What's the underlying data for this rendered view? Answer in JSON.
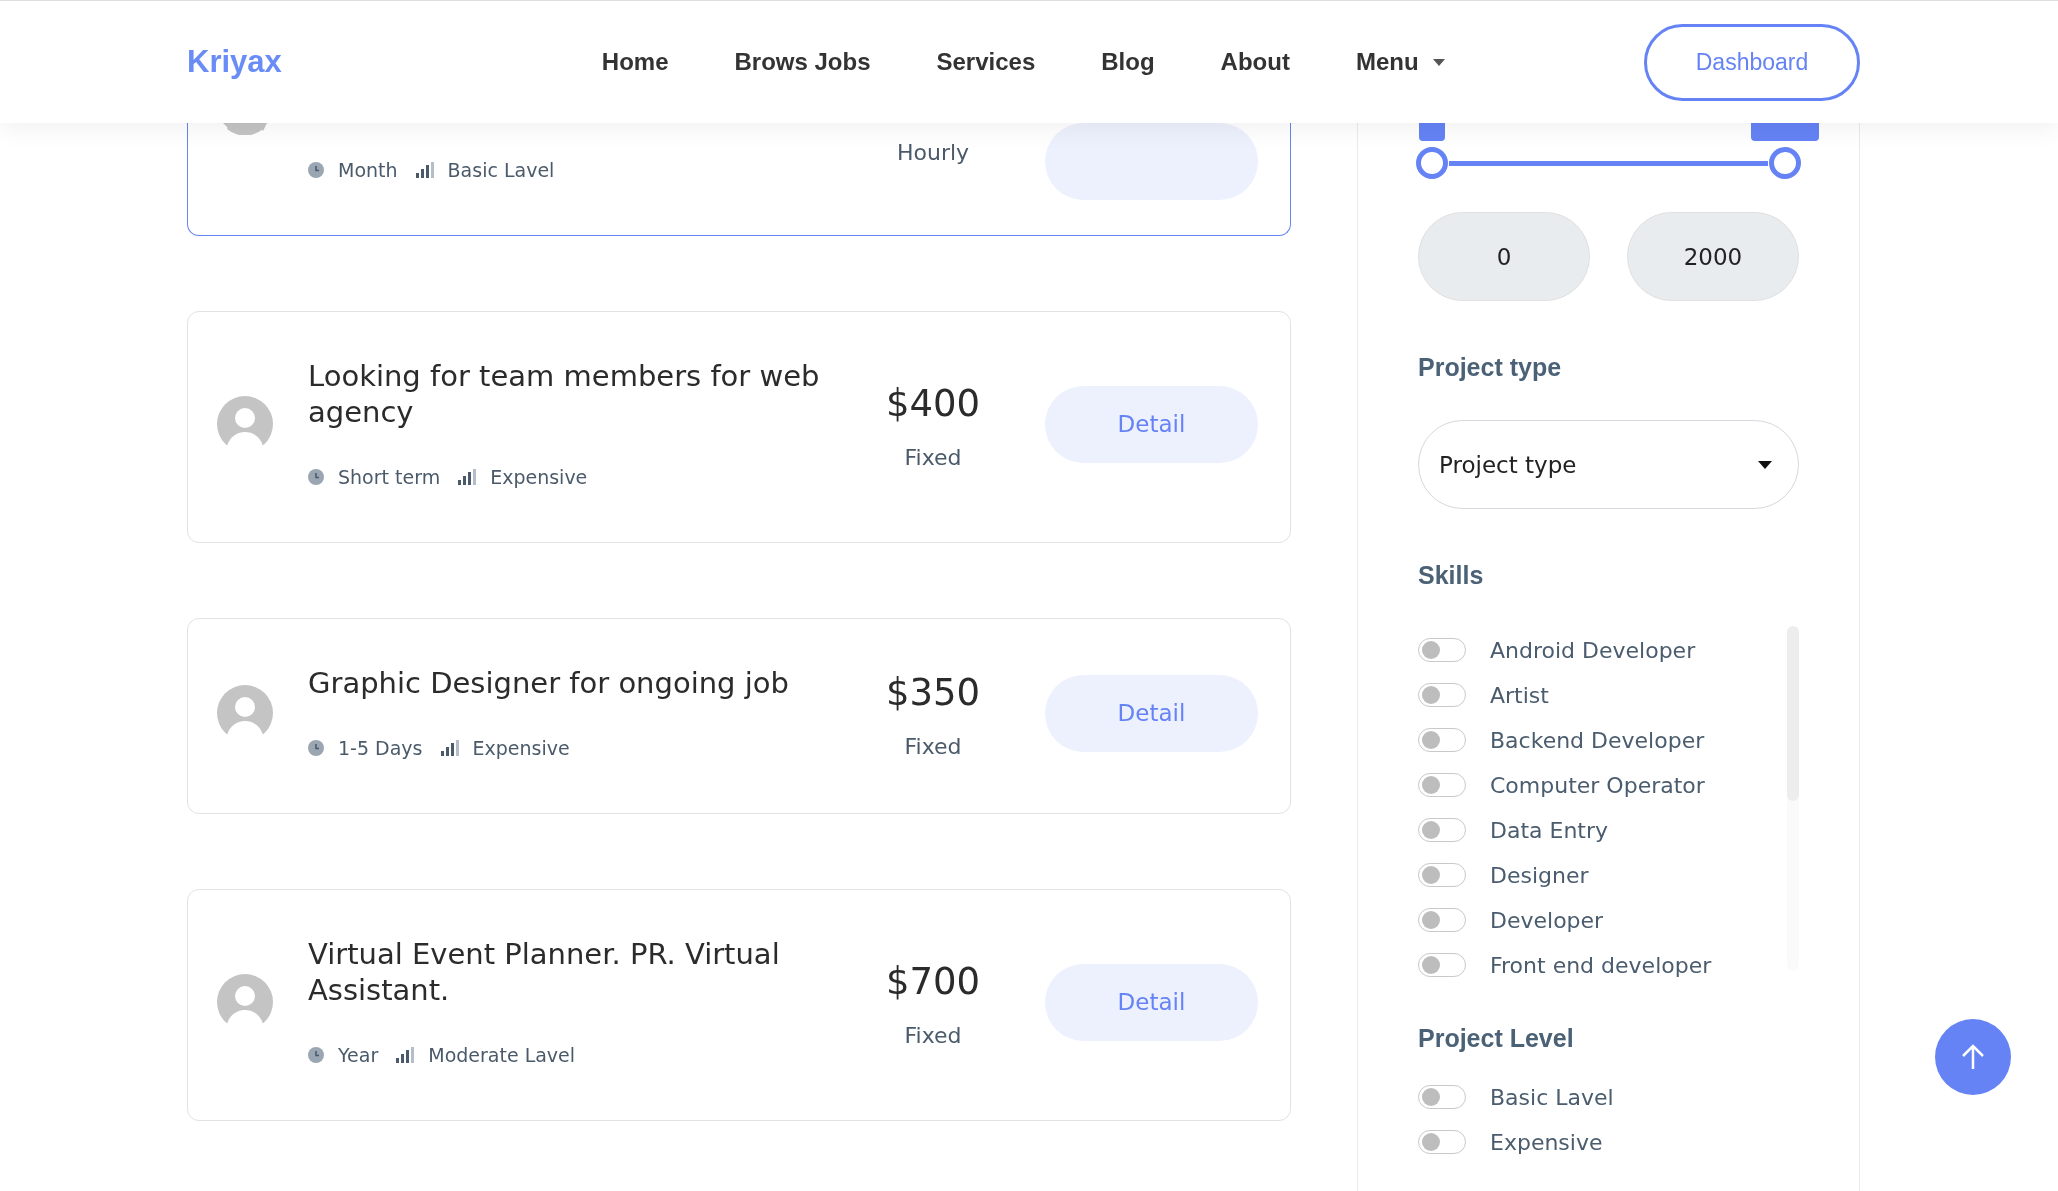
{
  "header": {
    "logo": "Kriyax",
    "nav": [
      {
        "label": "Home",
        "dropdown": false
      },
      {
        "label": "Brows Jobs",
        "dropdown": false
      },
      {
        "label": "Services",
        "dropdown": false
      },
      {
        "label": "Blog",
        "dropdown": false
      },
      {
        "label": "About",
        "dropdown": false
      },
      {
        "label": "Menu",
        "dropdown": true
      }
    ],
    "cta": "Dashboard"
  },
  "jobs": [
    {
      "kind": "partial",
      "duration": "Month",
      "level_text": "Basic Lavel",
      "pay_type": "Hourly"
    },
    {
      "kind": "full",
      "title": "Looking for team members for web agency",
      "price": "$400",
      "duration": "Short term",
      "level_text": "Expensive",
      "pay_type": "Fixed",
      "action": "Detail"
    },
    {
      "kind": "full",
      "title": "Graphic Designer for ongoing job",
      "price": "$350",
      "duration": "1-5 Days",
      "level_text": "Expensive",
      "pay_type": "Fixed",
      "action": "Detail"
    },
    {
      "kind": "full",
      "title": "Virtual Event Planner. PR. Virtual Assistant.",
      "price": "$700",
      "duration": "Year",
      "level_text": "Moderate Lavel",
      "pay_type": "Fixed",
      "action": "Detail"
    }
  ],
  "sidebar": {
    "price_slider": {
      "thumbs": [
        {
          "level": 0
        },
        {
          "level": 1
        }
      ]
    },
    "min_value": "0",
    "max_value": "2000",
    "project_type": {
      "heading": "Project type",
      "select": "Project type"
    },
    "skills": {
      "heading": "Skills",
      "items": [
        {
          "label": "Android Developer",
          "on": false
        },
        {
          "label": "Artist",
          "on": false
        },
        {
          "label": "Backend Developer",
          "on": false
        },
        {
          "label": "Computer Operator",
          "on": false
        },
        {
          "label": "Data Entry",
          "on": false
        },
        {
          "label": "Designer",
          "on": false
        },
        {
          "label": "Developer",
          "on": false
        },
        {
          "label": "Front end developer",
          "on": false
        }
      ]
    },
    "project_level": {
      "heading": "Project Level",
      "items": [
        {
          "label": "Basic Lavel",
          "on": false
        },
        {
          "label": "Expensive",
          "on": false
        }
      ]
    }
  }
}
